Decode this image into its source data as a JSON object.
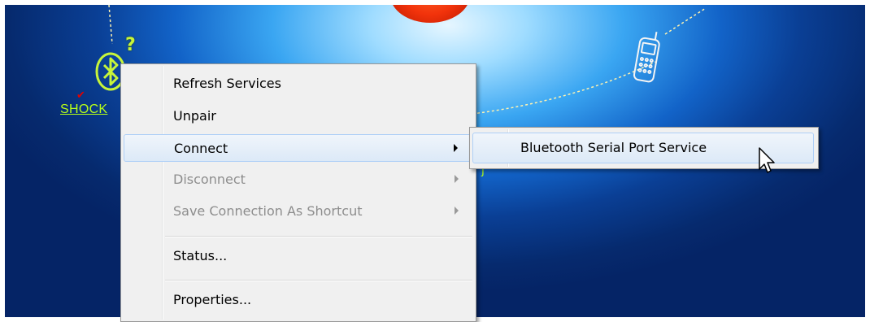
{
  "device": {
    "label": "SHOCK",
    "status_mark": "✔",
    "unknown_mark": "?",
    "icon": "bluetooth-icon"
  },
  "phone_icon": "mobile-phone-icon",
  "colors": {
    "menu_bg": "#f0f0f0",
    "highlight": "#dce9f7",
    "device_label": "#b8ff18",
    "orb": "#f2330b"
  },
  "context_menu": {
    "items": [
      {
        "label": "Refresh Services",
        "enabled": true,
        "has_submenu": false
      },
      {
        "label": "Unpair",
        "enabled": true,
        "has_submenu": false
      },
      {
        "label": "Connect",
        "enabled": true,
        "has_submenu": true,
        "highlighted": true
      },
      {
        "label": "Disconnect",
        "enabled": false,
        "has_submenu": true
      },
      {
        "label": "Save Connection As Shortcut",
        "enabled": false,
        "has_submenu": true
      },
      {
        "label": "Status...",
        "enabled": true,
        "has_submenu": false
      },
      {
        "label": "Properties...",
        "enabled": true,
        "has_submenu": false
      }
    ]
  },
  "submenu": {
    "items": [
      {
        "label": "Bluetooth Serial Port Service",
        "highlighted": true
      }
    ]
  }
}
